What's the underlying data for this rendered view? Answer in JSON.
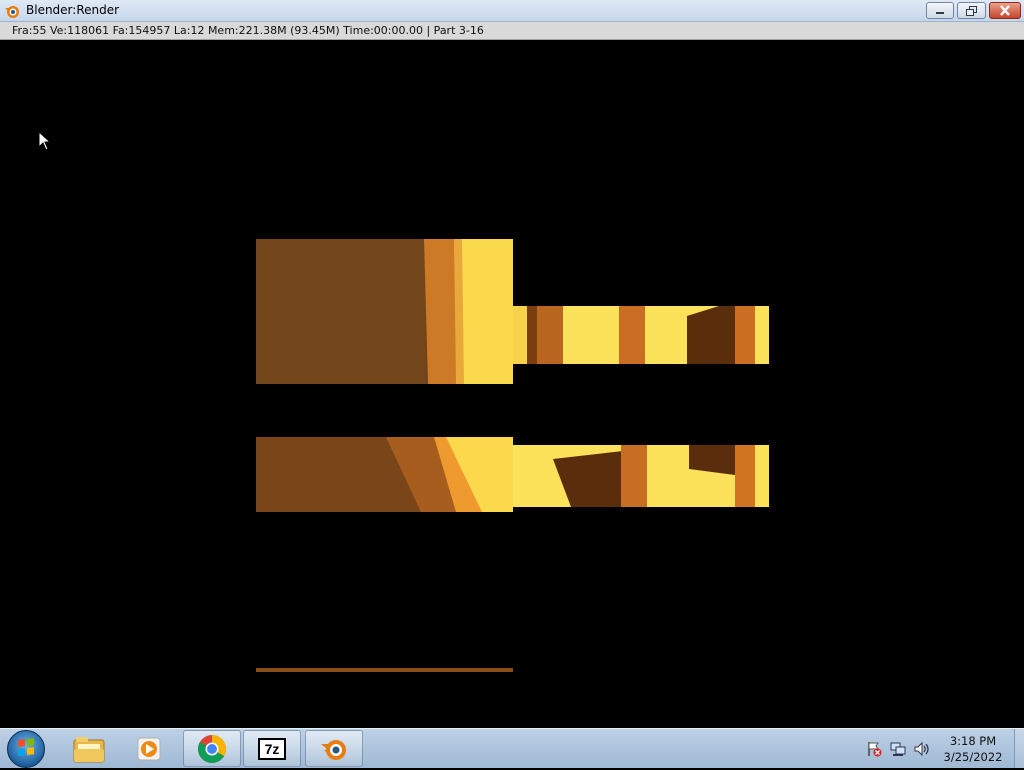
{
  "window": {
    "title": "Blender:Render",
    "controls": {
      "minimize": "minimize-icon",
      "maximize": "restore-icon",
      "close": "close-icon"
    }
  },
  "render_info": {
    "text": "Fra:55  Ve:118061  Fa:154957  La:12  Mem:221.38M (93.45M) Time:00:00.00 | Part 3-16"
  },
  "render_area": {
    "background": "#000000",
    "tile_palette": [
      "#6a3d12",
      "#8a4e14",
      "#e0882c",
      "#f4c542",
      "#fde760",
      "#4a2608"
    ]
  },
  "taskbar": {
    "start_icon": "windows-orb-icon",
    "items": [
      {
        "name": "file-explorer-icon",
        "active": false
      },
      {
        "name": "media-player-icon",
        "active": false
      },
      {
        "name": "chrome-icon",
        "active": true
      },
      {
        "name": "7zip-icon",
        "active": true,
        "label": "7z"
      },
      {
        "name": "blender-icon",
        "active": true
      }
    ],
    "tray": [
      "action-center-flag-icon",
      "network-icon",
      "volume-icon"
    ],
    "clock": {
      "time": "3:18 PM",
      "date": "3/25/2022"
    }
  }
}
